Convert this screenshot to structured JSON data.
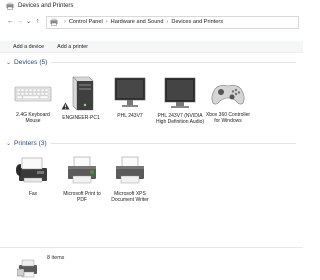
{
  "window": {
    "title": "Devices and Printers"
  },
  "nav": {
    "back": "←",
    "forward": "→",
    "recent": "⌄",
    "up": "↑"
  },
  "address": {
    "separator": "›",
    "crumbs": [
      "Control Panel",
      "Hardware and Sound",
      "Devices and Printers"
    ]
  },
  "commands": {
    "add_device": "Add a device",
    "add_printer": "Add a printer"
  },
  "devices": {
    "header": "Devices (5)",
    "items": [
      {
        "label": "2.4G Keyboard Mouse",
        "icon": "keyboard-icon"
      },
      {
        "label": "ENGINEER-PC1",
        "icon": "computer-tower-icon"
      },
      {
        "label": "PHL 243V7",
        "icon": "monitor-icon"
      },
      {
        "label": "PHL 243V7 (NVIDIA High Definition Audio)",
        "icon": "monitor-icon"
      },
      {
        "label": "Xbox 360 Controller for Windows",
        "icon": "gamepad-icon"
      }
    ]
  },
  "printers": {
    "header": "Printers (3)",
    "items": [
      {
        "label": "Fax",
        "icon": "fax-icon"
      },
      {
        "label": "Microsoft Print to PDF",
        "icon": "printer-icon"
      },
      {
        "label": "Microsoft XPS Document Writer",
        "icon": "printer-icon"
      }
    ]
  },
  "status": {
    "count": "8 items"
  },
  "colors": {
    "group_title": "#2a4a7a",
    "printer_check": "#3a9a3a"
  }
}
